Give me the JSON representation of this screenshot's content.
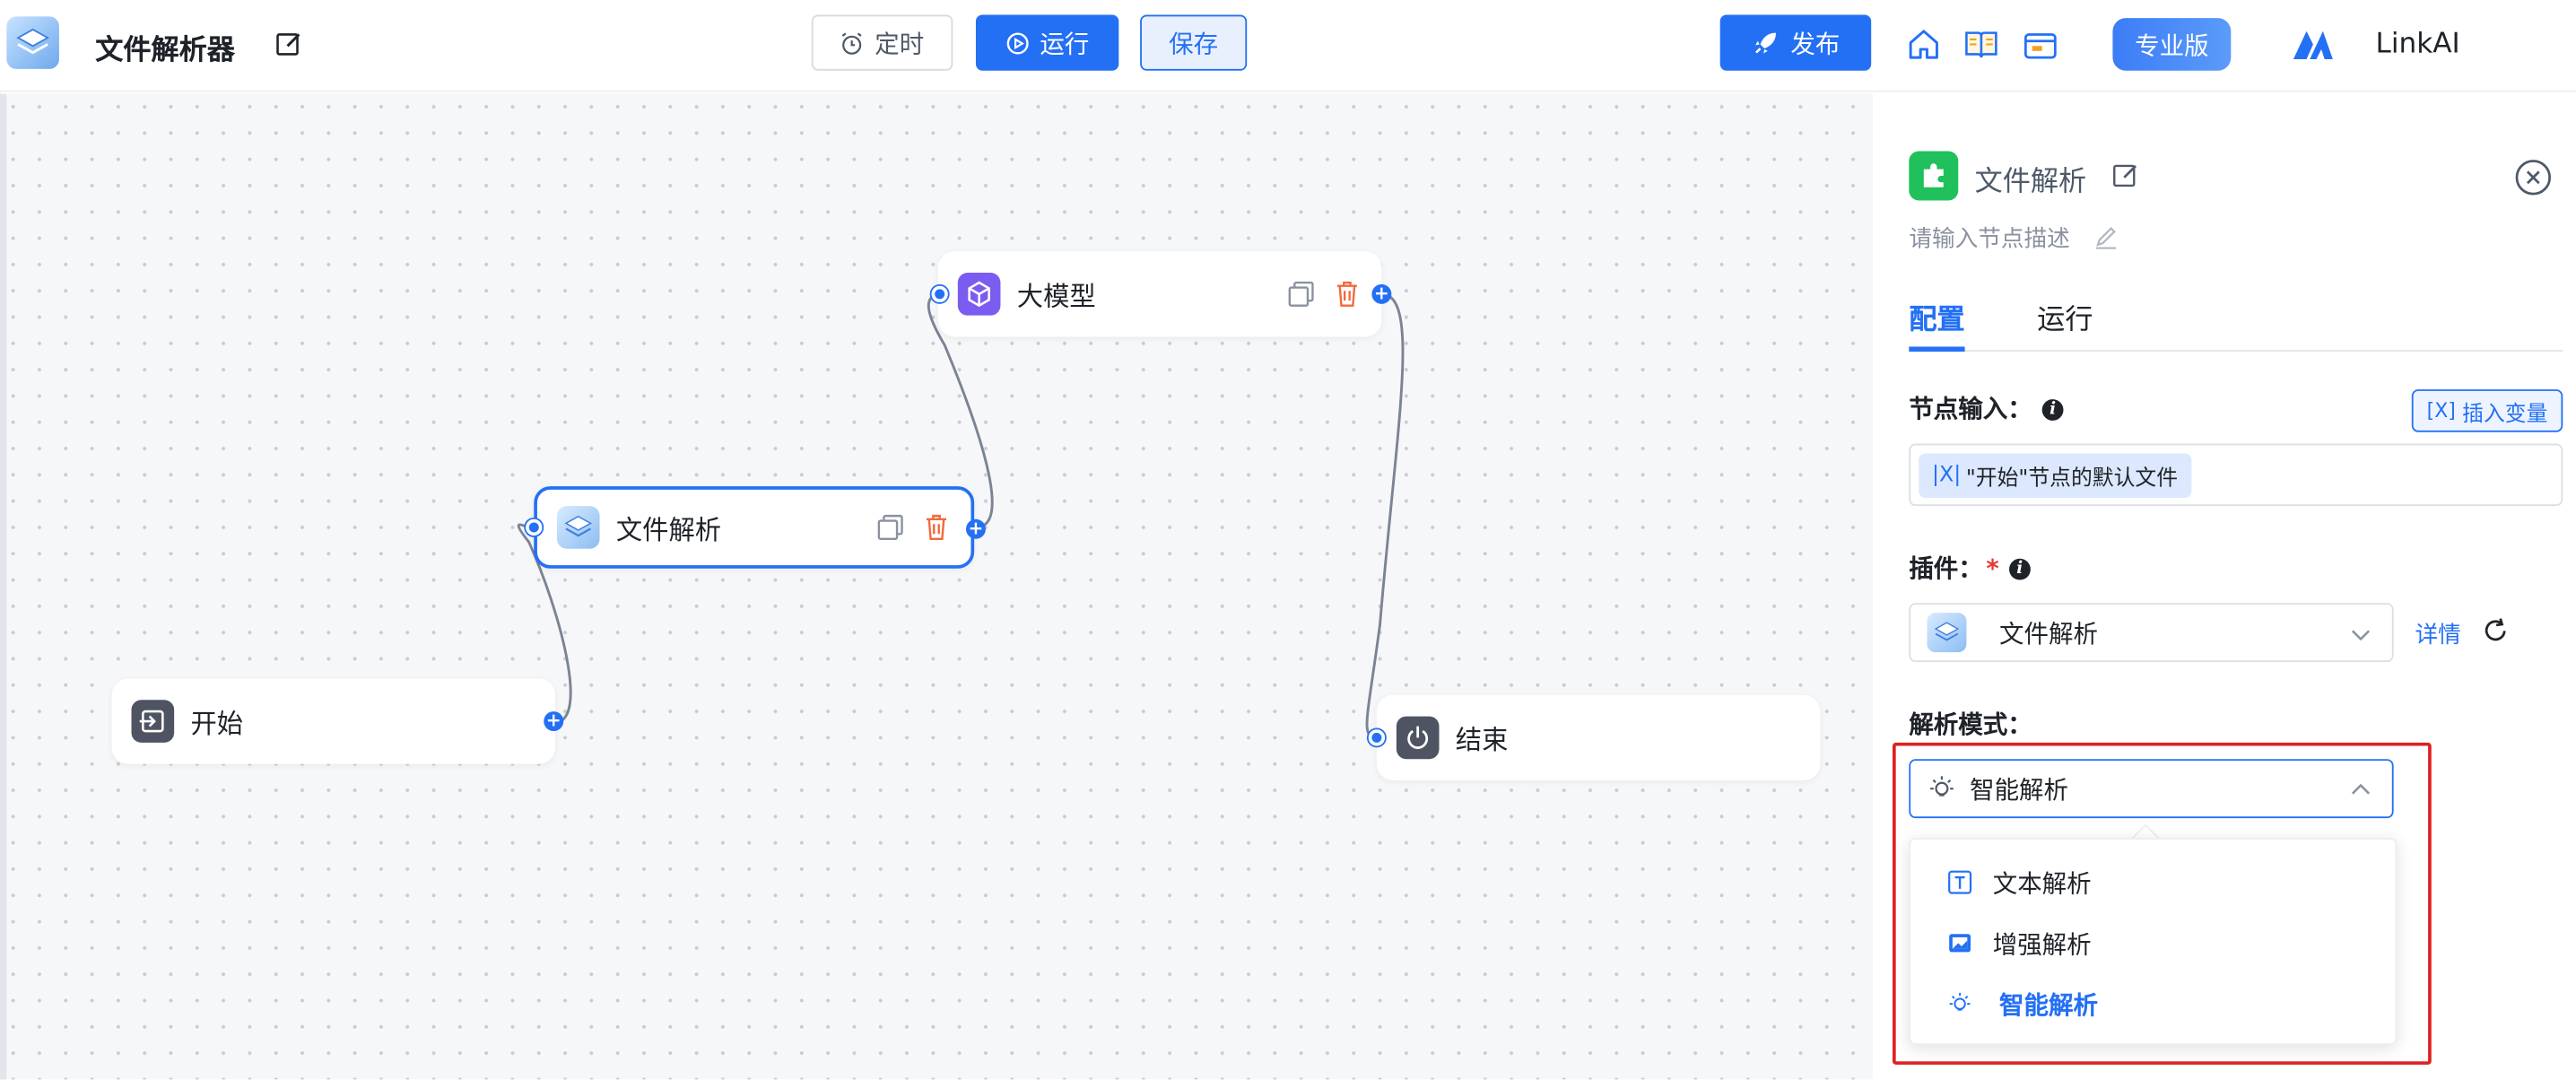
{
  "header": {
    "app_title": "文件解析器",
    "timer_label": "定时",
    "run_label": "运行",
    "save_label": "保存",
    "publish_label": "发布",
    "pro_label": "专业版",
    "brand_name": "LinkAI"
  },
  "canvas": {
    "nodes": {
      "start": "开始",
      "file_parse": "文件解析",
      "llm": "大模型",
      "end": "结束"
    }
  },
  "panel": {
    "title": "文件解析",
    "description_placeholder": "请输入节点描述",
    "tabs": [
      "配置",
      "运行"
    ],
    "node_input_label": "节点输入：",
    "insert_variable_label": "插入变量",
    "input_variable_tag": "\"开始\"节点的默认文件",
    "plugin_label": "插件：",
    "plugin_required_mark": "*",
    "plugin_value": "文件解析",
    "detail_link": "详情",
    "parse_mode_label": "解析模式：",
    "parse_mode_value": "智能解析",
    "parse_mode_options": [
      "文本解析",
      "增强解析",
      "智能解析"
    ]
  },
  "colors": {
    "accent": "#2470f5",
    "highlight": "#e02020",
    "plugin_green": "#20c05c",
    "llm_purple": "#7b5cf0"
  }
}
